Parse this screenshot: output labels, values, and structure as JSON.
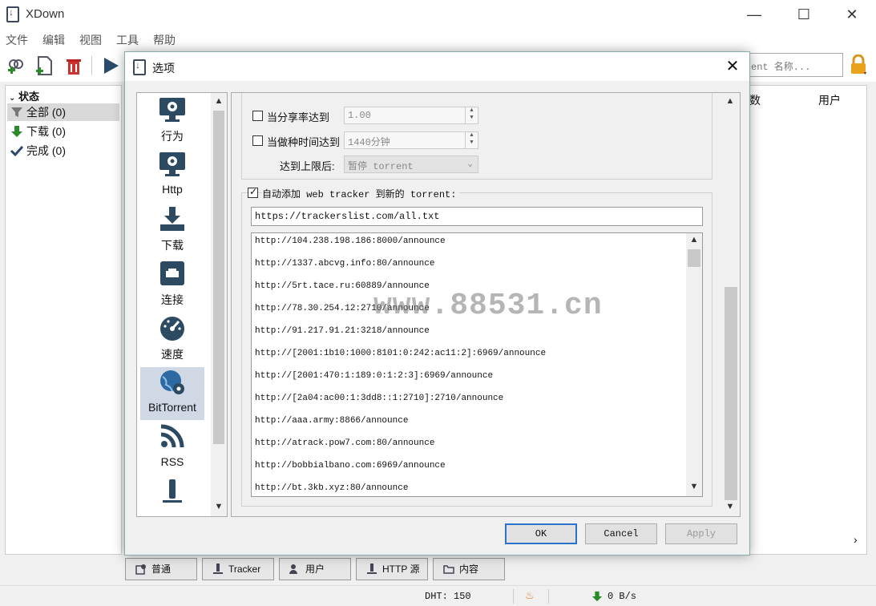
{
  "app": {
    "title": "XDown"
  },
  "menu": [
    "文件",
    "编辑",
    "视图",
    "工具",
    "帮助"
  ],
  "toolbar": {
    "search_placeholder": "ent 名称..."
  },
  "sidebar": {
    "header": "状态",
    "items": [
      {
        "label": "全部 (0)"
      },
      {
        "label": "下载 (0)"
      },
      {
        "label": "完成 (0)"
      }
    ]
  },
  "list_columns": [
    "数",
    "用户"
  ],
  "bottom_tabs": [
    "普通",
    "Tracker",
    "用户",
    "HTTP 源",
    "内容"
  ],
  "status": {
    "dht": "DHT: 150",
    "speed": "0 B/s"
  },
  "dialog": {
    "title": "选项",
    "categories": [
      {
        "label": "行为"
      },
      {
        "label": "Http"
      },
      {
        "label": "下载"
      },
      {
        "label": "连接"
      },
      {
        "label": "速度"
      },
      {
        "label": "BitTorrent"
      },
      {
        "label": "RSS"
      }
    ],
    "seeding": {
      "ratio_label": "当分享率达到",
      "ratio_value": "1.00",
      "time_label": "当做种时间达到",
      "time_value": "1440分钟",
      "after_label": "达到上限后:",
      "after_value": "暂停 torrent"
    },
    "auto_tracker": {
      "label": "自动添加 web tracker 到新的 torrent:",
      "url": "https://trackerslist.com/all.txt",
      "trackers": [
        "http://104.238.198.186:8000/announce",
        "http://1337.abcvg.info:80/announce",
        "http://5rt.tace.ru:60889/announce",
        "http://78.30.254.12:2710/announce",
        "http://91.217.91.21:3218/announce",
        "http://[2001:1b10:1000:8101:0:242:ac11:2]:6969/announce",
        "http://[2001:470:1:189:0:1:2:3]:6969/announce",
        "http://[2a04:ac00:1:3dd8::1:2710]:2710/announce",
        "http://aaa.army:8866/announce",
        "http://atrack.pow7.com:80/announce",
        "http://bobbialbano.com:6969/announce",
        "http://bt.3kb.xyz:80/announce"
      ]
    },
    "buttons": {
      "ok": "OK",
      "cancel": "Cancel",
      "apply": "Apply"
    }
  },
  "watermark": "www.88531.cn"
}
